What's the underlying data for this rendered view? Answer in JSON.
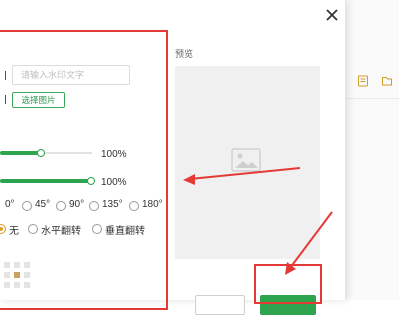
{
  "dialog": {
    "close_icon": "close-icon",
    "preview_label": "预览",
    "preview_image_icon": "image-placeholder-icon"
  },
  "text_watermark": {
    "placeholder": "请输入水印文字",
    "value": ""
  },
  "image_watermark": {
    "choose_label": "选择图片"
  },
  "sliders": [
    {
      "value": 0.4,
      "label": "100%"
    },
    {
      "value": 1.0,
      "label": "100%"
    }
  ],
  "rotation": {
    "options": [
      "0°",
      "45°",
      "90°",
      "135°",
      "180°"
    ],
    "selected": "0°"
  },
  "flip": {
    "options": [
      "无",
      "水平翻转",
      "垂直翻转"
    ],
    "selected": "无"
  },
  "position_grid": {
    "rows": 3,
    "cols": 3,
    "selected": 4
  },
  "annotations": {
    "color": "#e53935"
  },
  "colors": {
    "accent": "#2ea44f",
    "radio_selected": "#e2a12c"
  }
}
